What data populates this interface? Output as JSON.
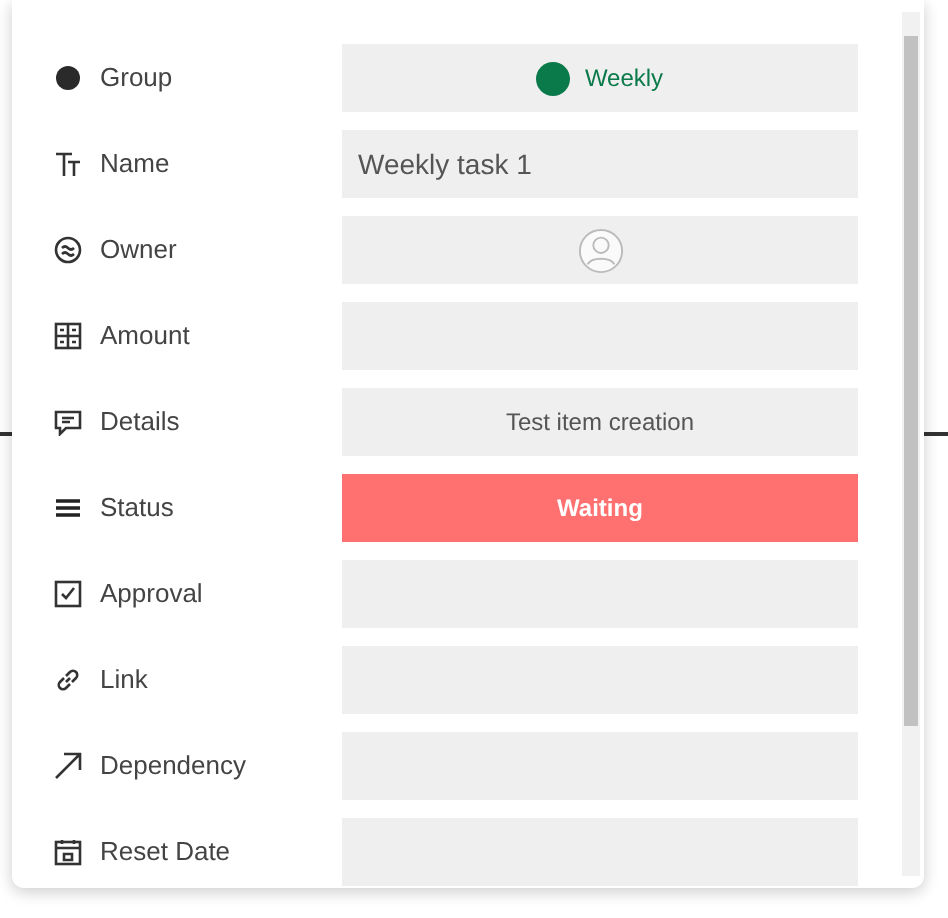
{
  "fields": [
    {
      "label": "Group",
      "value": {
        "kind": "group",
        "text": "Weekly",
        "color": "#0b7a4b"
      }
    },
    {
      "label": "Name",
      "value": {
        "kind": "text",
        "text": "Weekly task 1"
      }
    },
    {
      "label": "Owner",
      "value": {
        "kind": "person"
      }
    },
    {
      "label": "Amount",
      "value": {
        "kind": "empty"
      }
    },
    {
      "label": "Details",
      "value": {
        "kind": "centered",
        "text": "Test item creation"
      }
    },
    {
      "label": "Status",
      "value": {
        "kind": "status",
        "text": "Waiting",
        "color": "#ff7171"
      }
    },
    {
      "label": "Approval",
      "value": {
        "kind": "empty"
      }
    },
    {
      "label": "Link",
      "value": {
        "kind": "empty"
      }
    },
    {
      "label": "Dependency",
      "value": {
        "kind": "empty"
      }
    },
    {
      "label": "Reset Date",
      "value": {
        "kind": "empty"
      }
    }
  ]
}
